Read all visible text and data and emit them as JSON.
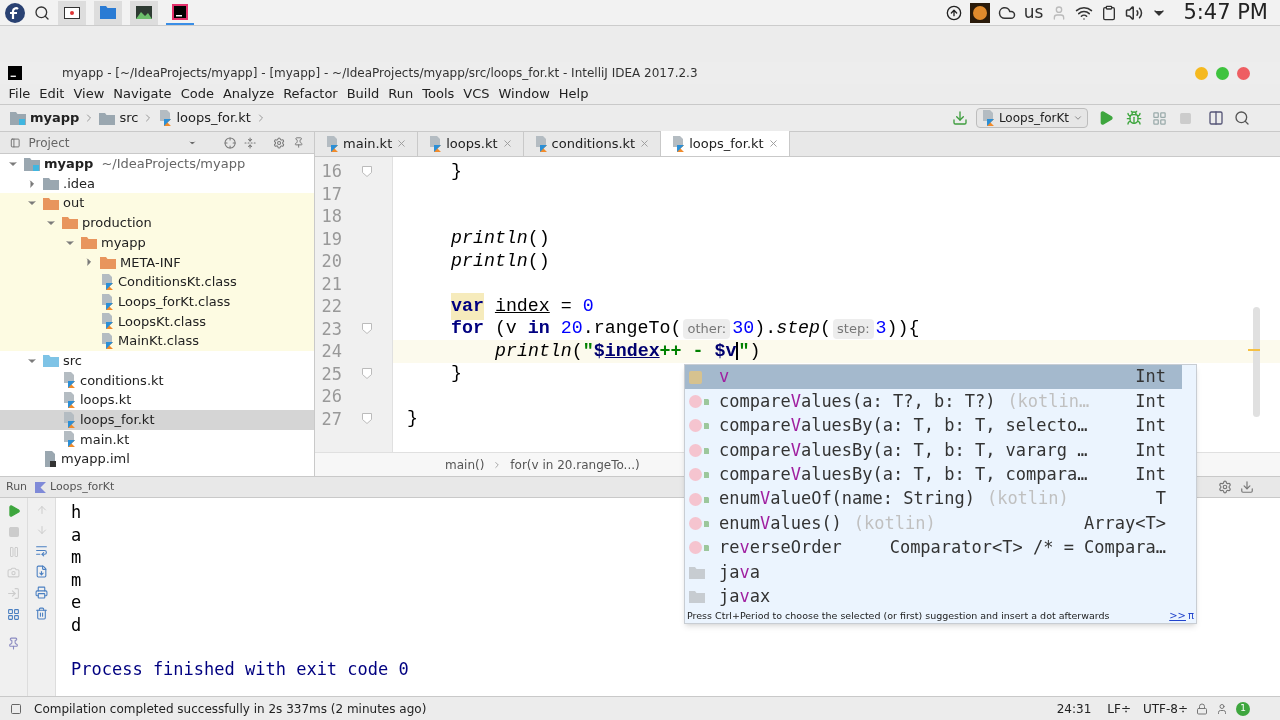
{
  "desktop_panel": {
    "keyboard_layout": "us",
    "clock": "5:47 PM"
  },
  "window": {
    "title": "myapp - [~/IdeaProjects/myapp] - [myapp] - ~/IdeaProjects/myapp/src/loops_for.kt - IntelliJ IDEA 2017.2.3"
  },
  "menu": [
    "File",
    "Edit",
    "View",
    "Navigate",
    "Code",
    "Analyze",
    "Refactor",
    "Build",
    "Run",
    "Tools",
    "VCS",
    "Window",
    "Help"
  ],
  "breadcrumbs": [
    {
      "label": "myapp",
      "kind": "module"
    },
    {
      "label": "src",
      "kind": "folder"
    },
    {
      "label": "loops_for.kt",
      "kind": "kotlin-file"
    }
  ],
  "run_configuration": "Loops_forKt",
  "project_panel": {
    "title": "Project",
    "tree": [
      {
        "label": "myapp",
        "note": "~/IdeaProjects/myapp",
        "kind": "module",
        "expanded": true,
        "selected": false,
        "children": [
          {
            "label": ".idea",
            "kind": "folder",
            "expanded": false,
            "selected": false
          },
          {
            "label": "out",
            "kind": "excluded-folder",
            "expanded": true,
            "selected": false,
            "children": [
              {
                "label": "production",
                "kind": "excluded-folder",
                "expanded": true,
                "selected": false,
                "children": [
                  {
                    "label": "myapp",
                    "kind": "excluded-folder",
                    "expanded": true,
                    "selected": false,
                    "children": [
                      {
                        "label": "META-INF",
                        "kind": "excluded-folder",
                        "expanded": false,
                        "selected": false
                      },
                      {
                        "label": "ConditionsKt.class",
                        "kind": "class-file",
                        "selected": false
                      },
                      {
                        "label": "Loops_forKt.class",
                        "kind": "class-file",
                        "selected": false
                      },
                      {
                        "label": "LoopsKt.class",
                        "kind": "class-file",
                        "selected": false
                      },
                      {
                        "label": "MainKt.class",
                        "kind": "class-file",
                        "selected": false
                      }
                    ]
                  }
                ]
              }
            ]
          },
          {
            "label": "src",
            "kind": "source-folder",
            "expanded": true,
            "selected": false,
            "children": [
              {
                "label": "conditions.kt",
                "kind": "kotlin-file",
                "selected": false
              },
              {
                "label": "loops.kt",
                "kind": "kotlin-file",
                "selected": false
              },
              {
                "label": "loops_for.kt",
                "kind": "kotlin-file",
                "selected": true
              },
              {
                "label": "main.kt",
                "kind": "kotlin-file",
                "selected": false
              }
            ]
          },
          {
            "label": "myapp.iml",
            "kind": "iml-file",
            "selected": false
          }
        ]
      }
    ]
  },
  "editor_tabs": [
    {
      "label": "main.kt",
      "selected": false
    },
    {
      "label": "loops.kt",
      "selected": false
    },
    {
      "label": "conditions.kt",
      "selected": false
    },
    {
      "label": "loops_for.kt",
      "selected": true
    }
  ],
  "code_lines": [
    {
      "number": "16",
      "fold": true,
      "current": false,
      "tokens": [
        {
          "kind": "indent"
        },
        {
          "kind": "text",
          "text": "}"
        }
      ]
    },
    {
      "number": "17",
      "fold": false,
      "current": false
    },
    {
      "number": "18",
      "fold": false,
      "current": false
    },
    {
      "number": "19",
      "fold": false,
      "current": false,
      "tokens": [
        {
          "kind": "indent"
        },
        {
          "kind": "italic",
          "text": "println"
        },
        {
          "kind": "text",
          "text": "()"
        }
      ]
    },
    {
      "number": "20",
      "fold": false,
      "current": false,
      "tokens": [
        {
          "kind": "indent"
        },
        {
          "kind": "italic",
          "text": "println"
        },
        {
          "kind": "text",
          "text": "()"
        }
      ]
    },
    {
      "number": "21",
      "fold": false,
      "current": false
    },
    {
      "number": "22",
      "fold": false,
      "current": false,
      "tokens": [
        {
          "kind": "indent"
        },
        {
          "kind": "keyword-marked",
          "text": "var"
        },
        {
          "kind": "space"
        },
        {
          "kind": "underline",
          "text": "index"
        },
        {
          "kind": "text",
          "text": " = "
        },
        {
          "kind": "number",
          "text": "0"
        }
      ]
    },
    {
      "number": "23",
      "fold": true,
      "current": false,
      "tokens": [
        {
          "kind": "indent"
        },
        {
          "kind": "keyword",
          "text": "for"
        },
        {
          "kind": "text",
          "text": " (v "
        },
        {
          "kind": "keyword",
          "text": "in"
        },
        {
          "kind": "space"
        },
        {
          "kind": "number",
          "text": "20"
        },
        {
          "kind": "text",
          "text": ".rangeTo("
        },
        {
          "kind": "hint",
          "text": "other:"
        },
        {
          "kind": "number",
          "text": "30"
        },
        {
          "kind": "text",
          "text": ")."
        },
        {
          "kind": "italic",
          "text": "step"
        },
        {
          "kind": "text",
          "text": "("
        },
        {
          "kind": "hint",
          "text": "step:"
        },
        {
          "kind": "number",
          "text": "3"
        },
        {
          "kind": "text",
          "text": ")){"
        }
      ]
    },
    {
      "number": "24",
      "fold": false,
      "current": true,
      "tokens": [
        {
          "kind": "indent"
        },
        {
          "kind": "indent"
        },
        {
          "kind": "italic",
          "text": "println"
        },
        {
          "kind": "text",
          "text": "("
        },
        {
          "kind": "string",
          "text": "\""
        },
        {
          "kind": "template",
          "text": "$"
        },
        {
          "kind": "template-underline",
          "text": "index"
        },
        {
          "kind": "string",
          "text": "++ - "
        },
        {
          "kind": "template",
          "text": "$v"
        },
        {
          "kind": "caret"
        },
        {
          "kind": "string",
          "text": "\""
        },
        {
          "kind": "text",
          "text": ")"
        }
      ]
    },
    {
      "number": "25",
      "fold": true,
      "current": false,
      "tokens": [
        {
          "kind": "indent"
        },
        {
          "kind": "text",
          "text": "}"
        }
      ]
    },
    {
      "number": "26",
      "fold": false,
      "current": false
    },
    {
      "number": "27",
      "fold": true,
      "current": false,
      "tokens": [
        {
          "kind": "text",
          "text": "}"
        }
      ]
    }
  ],
  "editor_breadcrumbs": [
    "main()",
    "for(v in 20.rangeTo...)"
  ],
  "completion_popup": {
    "items": [
      {
        "kind": "variable",
        "match": "v",
        "type": "Int",
        "selected": true
      },
      {
        "kind": "function",
        "before": "compare",
        "match": "V",
        "after": "alues(a: T?, b: T?)",
        "tail": "(kotlin…",
        "type": "Int",
        "selected": false
      },
      {
        "kind": "function",
        "before": "compare",
        "match": "V",
        "after": "aluesBy(a: T, b: T, selecto…",
        "type": "Int",
        "selected": false
      },
      {
        "kind": "function",
        "before": "compare",
        "match": "V",
        "after": "aluesBy(a: T, b: T, vararg …",
        "type": "Int",
        "selected": false
      },
      {
        "kind": "function",
        "before": "compare",
        "match": "V",
        "after": "aluesBy(a: T, b: T, compara…",
        "type": "Int",
        "selected": false
      },
      {
        "kind": "function",
        "before": "enum",
        "match": "V",
        "after": "alueOf(name: String)",
        "tail": "(kotlin)",
        "type": "T",
        "selected": false
      },
      {
        "kind": "function",
        "before": "enum",
        "match": "V",
        "after": "alues()",
        "tail": "(kotlin)",
        "type": "Array<T>",
        "selected": false
      },
      {
        "kind": "function",
        "before": "re",
        "match": "v",
        "after": "erseOrder",
        "type": "Comparator<T> /* = Compara…",
        "selected": false
      },
      {
        "kind": "package",
        "before": "ja",
        "match": "v",
        "after": "a",
        "selected": false
      },
      {
        "kind": "package",
        "before": "ja",
        "match": "v",
        "after": "ax",
        "selected": false
      }
    ],
    "footer": "Press Ctrl+Period to choose the selected (or first) suggestion and insert a dot afterwards",
    "footer_link": ">>",
    "footer_symbol": "π"
  },
  "run_panel": {
    "title": "Run",
    "configuration": "Loops_forKt",
    "output": [
      "h",
      "a",
      "m",
      "m",
      "e",
      "d"
    ],
    "exit_message": "Process finished with exit code 0"
  },
  "status_bar": {
    "message": "Compilation completed successfully in 2s 337ms (2 minutes ago)",
    "position": "24:31",
    "line_separator": "LF÷",
    "encoding": "UTF-8÷",
    "notifications": "1"
  }
}
